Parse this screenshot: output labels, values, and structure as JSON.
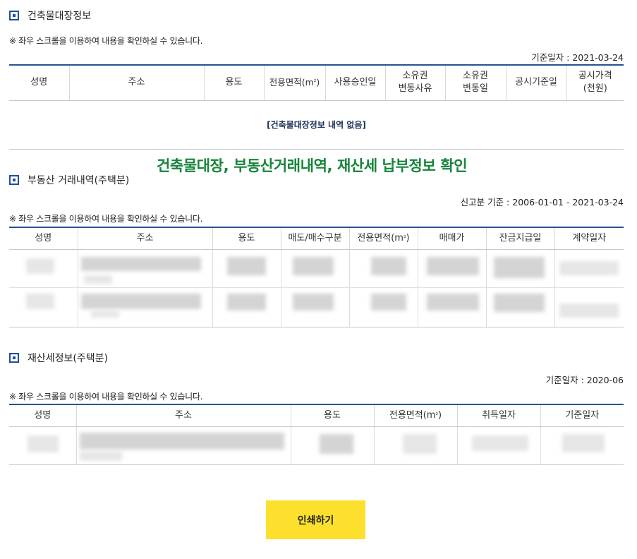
{
  "building": {
    "title": "건축물대장정보",
    "notice": "※ 좌우 스크롤을 이용하여 내용을 확인하실 수 있습니다.",
    "std_date": "기준일자 : 2021-03-24",
    "headers": [
      "성명",
      "주소",
      "용도",
      "전용면적(㎡)",
      "사용승인일",
      "소유권\n변동사유",
      "소유권\n변동일",
      "공시기준일",
      "공시가격\n(천원)"
    ],
    "empty_message": "[건축물대장정보 내역 없음]"
  },
  "caption": "건축물대장, 부동산거래내역, 재산세 납부정보 확인",
  "realestate": {
    "title": "부동산 거래내역(주택분)",
    "std_date": "신고분 기준 : 2006-01-01 - 2021-03-24",
    "notice": "※ 좌우 스크롤을 이용하여 내용을 확인하실 수 있습니다.",
    "headers": [
      "성명",
      "주소",
      "용도",
      "매도/매수구분",
      "전용면적(㎡)",
      "매매가",
      "잔금지급일",
      "계약일자"
    ]
  },
  "property_tax": {
    "title": "재산세정보(주택분)",
    "std_date": "기준일자 : 2020-06",
    "notice": "※ 좌우 스크롤을 이용하여 내용을 확인하실 수 있습니다.",
    "headers": [
      "성명",
      "주소",
      "용도",
      "전용면적(㎡)",
      "취득일자",
      "기준일자"
    ]
  },
  "print_button": "인쇄하기",
  "colors": {
    "accent": "#27528f",
    "caption": "#16843a",
    "button": "#fde02d"
  }
}
